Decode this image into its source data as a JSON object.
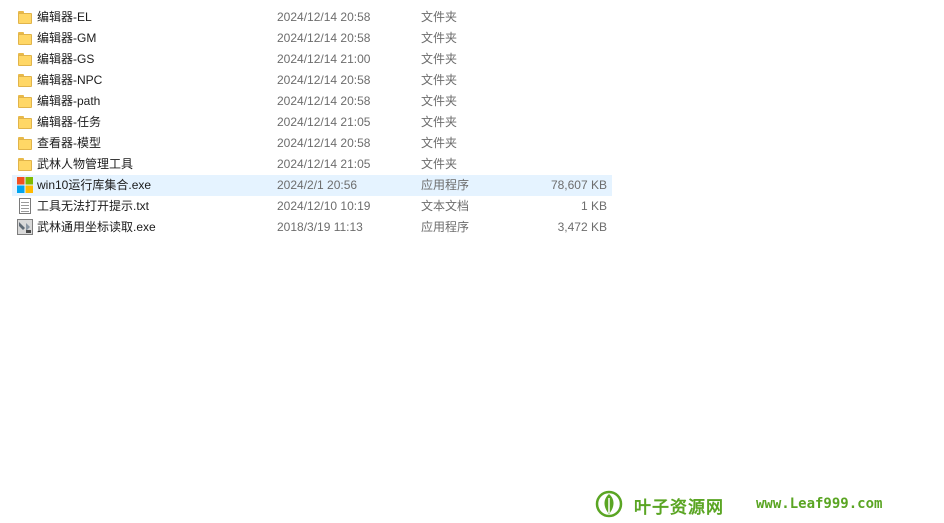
{
  "files": [
    {
      "name": "编辑器-EL",
      "date": "2024/12/14 20:58",
      "type": "文件夹",
      "size": "",
      "icon": "folder-icon"
    },
    {
      "name": "编辑器-GM",
      "date": "2024/12/14 20:58",
      "type": "文件夹",
      "size": "",
      "icon": "folder-icon"
    },
    {
      "name": "编辑器-GS",
      "date": "2024/12/14 21:00",
      "type": "文件夹",
      "size": "",
      "icon": "folder-icon"
    },
    {
      "name": "编辑器-NPC",
      "date": "2024/12/14 20:58",
      "type": "文件夹",
      "size": "",
      "icon": "folder-icon"
    },
    {
      "name": "编辑器-path",
      "date": "2024/12/14 20:58",
      "type": "文件夹",
      "size": "",
      "icon": "folder-icon"
    },
    {
      "name": "编辑器-任务",
      "date": "2024/12/14 21:05",
      "type": "文件夹",
      "size": "",
      "icon": "folder-icon"
    },
    {
      "name": "查看器-模型",
      "date": "2024/12/14 20:58",
      "type": "文件夹",
      "size": "",
      "icon": "folder-icon"
    },
    {
      "name": "武林人物管理工具",
      "date": "2024/12/14 21:05",
      "type": "文件夹",
      "size": "",
      "icon": "folder-icon"
    },
    {
      "name": "win10运行库集合.exe",
      "date": "2024/2/1 20:56",
      "type": "应用程序",
      "size": "78,607 KB",
      "icon": "windows-logo-icon"
    },
    {
      "name": "工具无法打开提示.txt",
      "date": "2024/12/10 10:19",
      "type": "文本文档",
      "size": "1 KB",
      "icon": "text-document-icon"
    },
    {
      "name": "武林通用坐标读取.exe",
      "date": "2018/3/19 11:13",
      "type": "应用程序",
      "size": "3,472 KB",
      "icon": "application-icon"
    }
  ],
  "selected_row": 8,
  "watermark": {
    "cn_text": "叶子资源网",
    "url": "www.Leaf999.com",
    "icon": "leaf-logo-icon",
    "color": "#5aa523"
  },
  "colors": {
    "selection": "#e5f3ff",
    "folder": "#ffd766",
    "secondary_text": "#6d6d6d"
  }
}
